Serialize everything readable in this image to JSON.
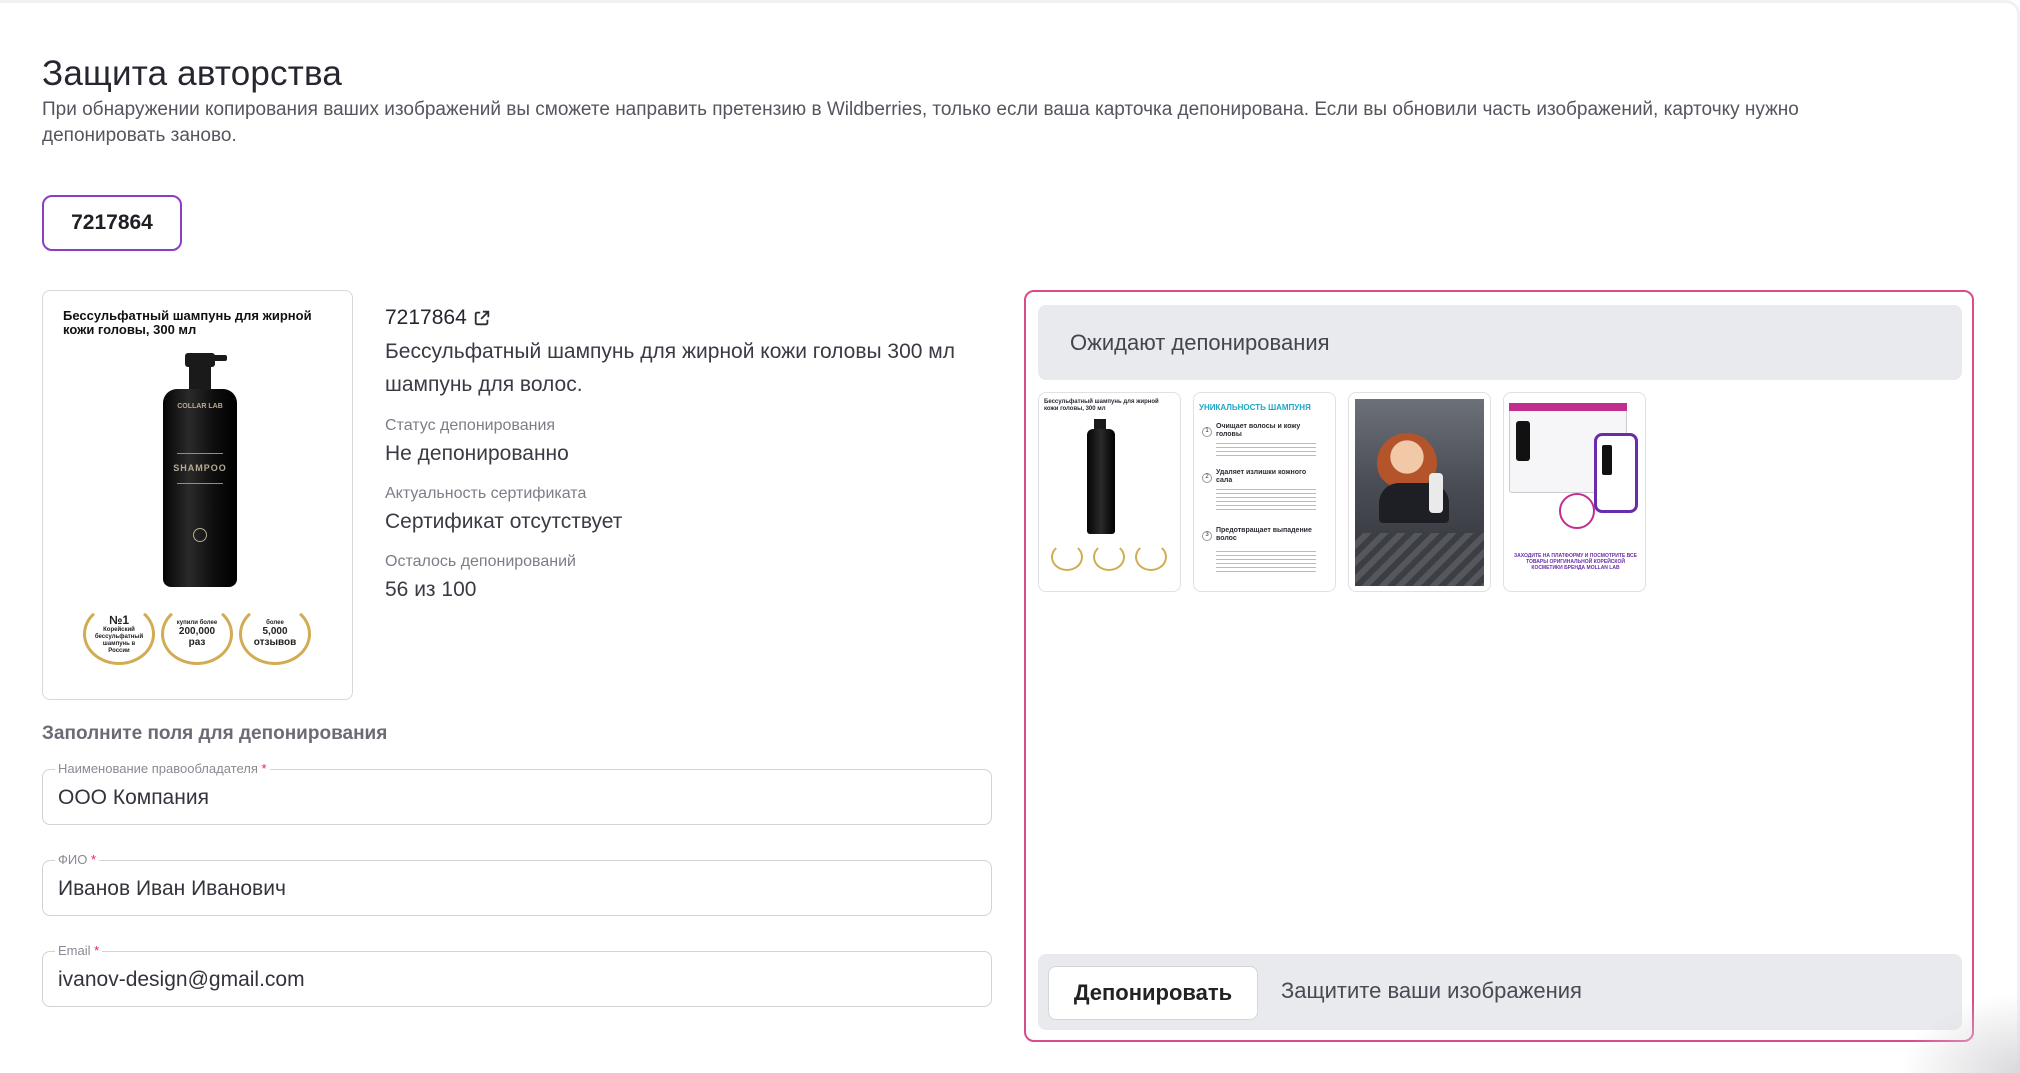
{
  "header": {
    "title": "Защита авторства",
    "subtitle": "При обнаружении копирования ваших изображений вы сможете направить претензию в Wildberries, только если ваша карточка депонирована. Если вы обновили часть изображений, карточку нужно депонировать заново."
  },
  "article_tab": {
    "label": "7217864"
  },
  "product": {
    "image_caption": "Бессульфатный шампунь для жирной кожи головы, 300 мл",
    "bottle_brand": "COLLAR LAB",
    "bottle_text": "SHAMPOO",
    "badges": [
      {
        "top": "№1",
        "text": "Корейский бессульфатный шампунь в России"
      },
      {
        "top": "купили более",
        "text": "200,000 раз"
      },
      {
        "top": "более",
        "text": "5,000 отзывов"
      }
    ],
    "sku": "7217864",
    "name": "Бессульфатный шампунь для жирной кожи головы 300 мл шампунь для волос.",
    "status_label": "Статус депонирования",
    "status_value": "Не депонированно",
    "cert_label": "Актуальность сертификата",
    "cert_value": "Сертификат отсутствует",
    "remaining_label": "Осталось депонирований",
    "remaining_value": "56 из 100"
  },
  "form": {
    "heading": "Заполните поля для депонирования",
    "fields": [
      {
        "label": "Наименование правообладателя",
        "required": "*",
        "value": "ООО Компания"
      },
      {
        "label": "ФИО",
        "required": "*",
        "value": "Иванов Иван Иванович"
      },
      {
        "label": "Email",
        "required": "*",
        "value": "ivanov-design@gmail.com"
      }
    ]
  },
  "pending": {
    "header": "Ожидают депонирования",
    "thumbs": [
      {
        "caption": "Бессульфатный шампунь для жирной кожи головы, 300 мл"
      },
      {
        "caption": "УНИКАЛЬНОСТЬ ШАМПУНЯ",
        "items": [
          "Очищает волосы и кожу головы",
          "Удаляет излишки кожного сала",
          "Предотвращает выпадение волос"
        ]
      },
      {
        "caption": ""
      },
      {
        "caption": "ЗАХОДИТЕ НА ПЛАТФОРМУ И ПОСМОТРИТЕ ВСЕ ТОВАРЫ ОРИГИНАЛЬНОЙ КОРЕЙСКОЙ КОСМЕТИКИ БРЕНДА MOLLAN LAB"
      }
    ],
    "button_label": "Депонировать",
    "action_text": "Защитите ваши изображения"
  },
  "colors": {
    "accent_purple": "#8b3dc6",
    "panel_border_pink": "#d94b8a",
    "required_red": "#e0245e",
    "panel_gray": "#e8eaee"
  }
}
